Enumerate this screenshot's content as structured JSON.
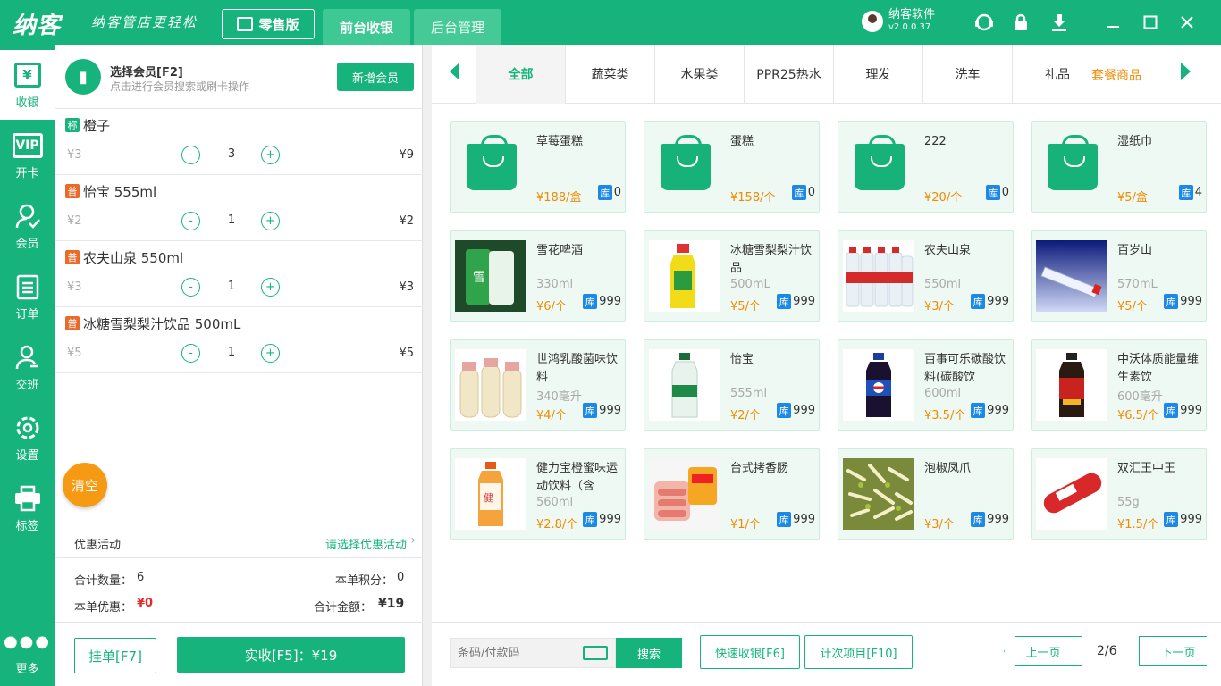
{
  "app": {
    "logo": "纳客",
    "slogan": "纳客管店更轻松",
    "edition": "零售版",
    "tabs": [
      "前台收银",
      "后台管理"
    ],
    "user_name": "纳客软件",
    "version": "v2.0.0.37"
  },
  "nav": [
    {
      "label": "收银",
      "icon": "cashier-icon"
    },
    {
      "label": "开卡",
      "icon": "vip-card-icon",
      "badge": "VIP"
    },
    {
      "label": "会员",
      "icon": "member-icon"
    },
    {
      "label": "订单",
      "icon": "order-icon"
    },
    {
      "label": "交班",
      "icon": "shift-icon"
    },
    {
      "label": "设置",
      "icon": "settings-icon"
    },
    {
      "label": "标签",
      "icon": "printer-icon"
    },
    {
      "label": "更多",
      "icon": "more-icon"
    }
  ],
  "member": {
    "title": "选择会员[F2]",
    "subtitle": "点击进行会员搜索或刷卡操作",
    "add_button": "新增会员"
  },
  "cart": [
    {
      "tag": "称",
      "name": "橙子",
      "price": "¥3",
      "qty": "3",
      "subtotal": "¥9"
    },
    {
      "tag": "普",
      "name": "怡宝 555ml",
      "price": "¥2",
      "qty": "1",
      "subtotal": "¥2"
    },
    {
      "tag": "普",
      "name": "农夫山泉 550ml",
      "price": "¥3",
      "qty": "1",
      "subtotal": "¥3"
    },
    {
      "tag": "普",
      "name": "冰糖雪梨梨汁饮品 500mL",
      "price": "¥5",
      "qty": "1",
      "subtotal": "¥5"
    }
  ],
  "clear_label": "清空",
  "promo": {
    "label": "优惠活动",
    "select": "请选择优惠活动"
  },
  "totals": {
    "qty_label": "合计数量：",
    "qty": "6",
    "points_label": "本单积分：",
    "points": "0",
    "discount_label": "本单优惠：",
    "discount": "¥0",
    "amount_label": "合计金额：",
    "amount": "¥19"
  },
  "hang_button": "挂单[F7]",
  "pay_button": "实收[F5]：¥19",
  "categories": [
    "全部",
    "蔬菜类",
    "水果类",
    "PPR25热水",
    "理发",
    "洗车",
    "礼品"
  ],
  "category_extra": "套餐商品",
  "products": [
    {
      "name": "草莓蛋糕",
      "spec": "",
      "price": "¥188/盒",
      "stock": "0",
      "img": "bag"
    },
    {
      "name": "蛋糕",
      "spec": "",
      "price": "¥158/个",
      "stock": "0",
      "img": "bag"
    },
    {
      "name": "222",
      "spec": "",
      "price": "¥20/个",
      "stock": "0",
      "img": "bag"
    },
    {
      "name": "湿纸巾",
      "spec": "",
      "price": "¥5/盒",
      "stock": "4",
      "img": "bag"
    },
    {
      "name": "雪花啤酒",
      "spec": "330ml",
      "price": "¥6/个",
      "stock": "999",
      "img": "beer"
    },
    {
      "name": "冰糖雪梨梨汁饮品",
      "spec": "500mL",
      "price": "¥5/个",
      "stock": "999",
      "img": "pear"
    },
    {
      "name": "农夫山泉",
      "spec": "550ml",
      "price": "¥3/个",
      "stock": "999",
      "img": "water"
    },
    {
      "name": "百岁山",
      "spec": "570mL",
      "price": "¥5/个",
      "stock": "999",
      "img": "baisui"
    },
    {
      "name": "世鸿乳酸菌味饮料",
      "spec": "340毫升",
      "price": "¥4/个",
      "stock": "999",
      "img": "yogurt"
    },
    {
      "name": "怡宝",
      "spec": "555ml",
      "price": "¥2/个",
      "stock": "999",
      "img": "yibao"
    },
    {
      "name": "百事可乐碳酸饮料(碳酸饮",
      "spec": "600ml",
      "price": "¥3.5/个",
      "stock": "999",
      "img": "pepsi"
    },
    {
      "name": "中沃体质能量维生素饮",
      "spec": "600毫升",
      "price": "¥6.5/个",
      "stock": "999",
      "img": "energy"
    },
    {
      "name": "健力宝橙蜜味运动饮料（含",
      "spec": "560ml",
      "price": "¥2.8/个",
      "stock": "999",
      "img": "orange"
    },
    {
      "name": "台式拷香肠",
      "spec": "",
      "price": "¥1/个",
      "stock": "999",
      "img": "sausage"
    },
    {
      "name": "泡椒凤爪",
      "spec": "",
      "price": "¥3/个",
      "stock": "999",
      "img": "feet"
    },
    {
      "name": "双汇王中王",
      "spec": "55g",
      "price": "¥1.5/个",
      "stock": "999",
      "img": "ham"
    }
  ],
  "stock_tag": "库",
  "search": {
    "placeholder": "条码/付款码",
    "button": "搜索"
  },
  "quick_cash": "快速收银[F6]",
  "count_items": "计次项目[F10]",
  "pager": {
    "prev": "上一页",
    "page": "2/6",
    "next": "下一页"
  },
  "colors": {
    "brand": "#16b47c",
    "price": "#f08a00",
    "stock_badge": "#1e88e5",
    "clear": "#f59a12",
    "discount": "#e62828"
  }
}
